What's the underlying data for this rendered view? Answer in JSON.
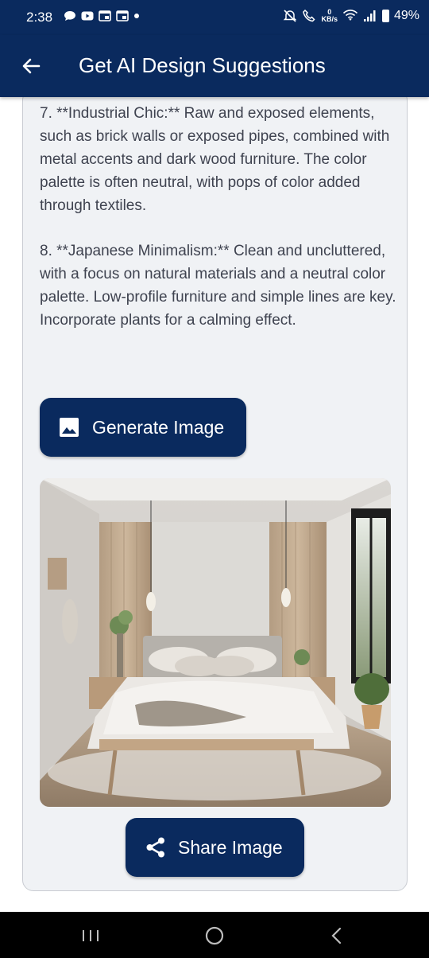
{
  "status_bar": {
    "time": "2:38",
    "kbs_value": "0",
    "kbs_unit": "KB/s",
    "battery": "49%",
    "icons": [
      "message-bubble-icon",
      "youtube-icon",
      "calendar-icon",
      "calendar-icon",
      "dot-icon",
      "alarm-off-icon",
      "call-icon",
      "wifi-icon",
      "signal-icon",
      "battery-icon"
    ]
  },
  "app_bar": {
    "title": "Get AI Design Suggestions",
    "back_icon": "arrow-left-icon"
  },
  "suggestions": [
    "7. **Industrial Chic:** Raw and exposed elements, such as brick walls or exposed pipes, combined with metal accents and dark wood furniture.  The color palette is often neutral, with pops of color added through textiles.",
    "8. **Japanese Minimalism:**  Clean and uncluttered, with a focus on natural materials and a neutral color palette.  Low-profile furniture and simple lines are key.  Incorporate plants for a calming effect."
  ],
  "buttons": {
    "generate_label": "Generate Image",
    "generate_icon": "image-icon",
    "share_label": "Share Image",
    "share_icon": "share-icon"
  },
  "nav": {
    "icons": [
      "recent-apps-icon",
      "home-icon",
      "back-icon"
    ]
  },
  "colors": {
    "primary": "#0a2a5e",
    "card_bg": "#f0f2f5",
    "text": "#3f4350"
  }
}
